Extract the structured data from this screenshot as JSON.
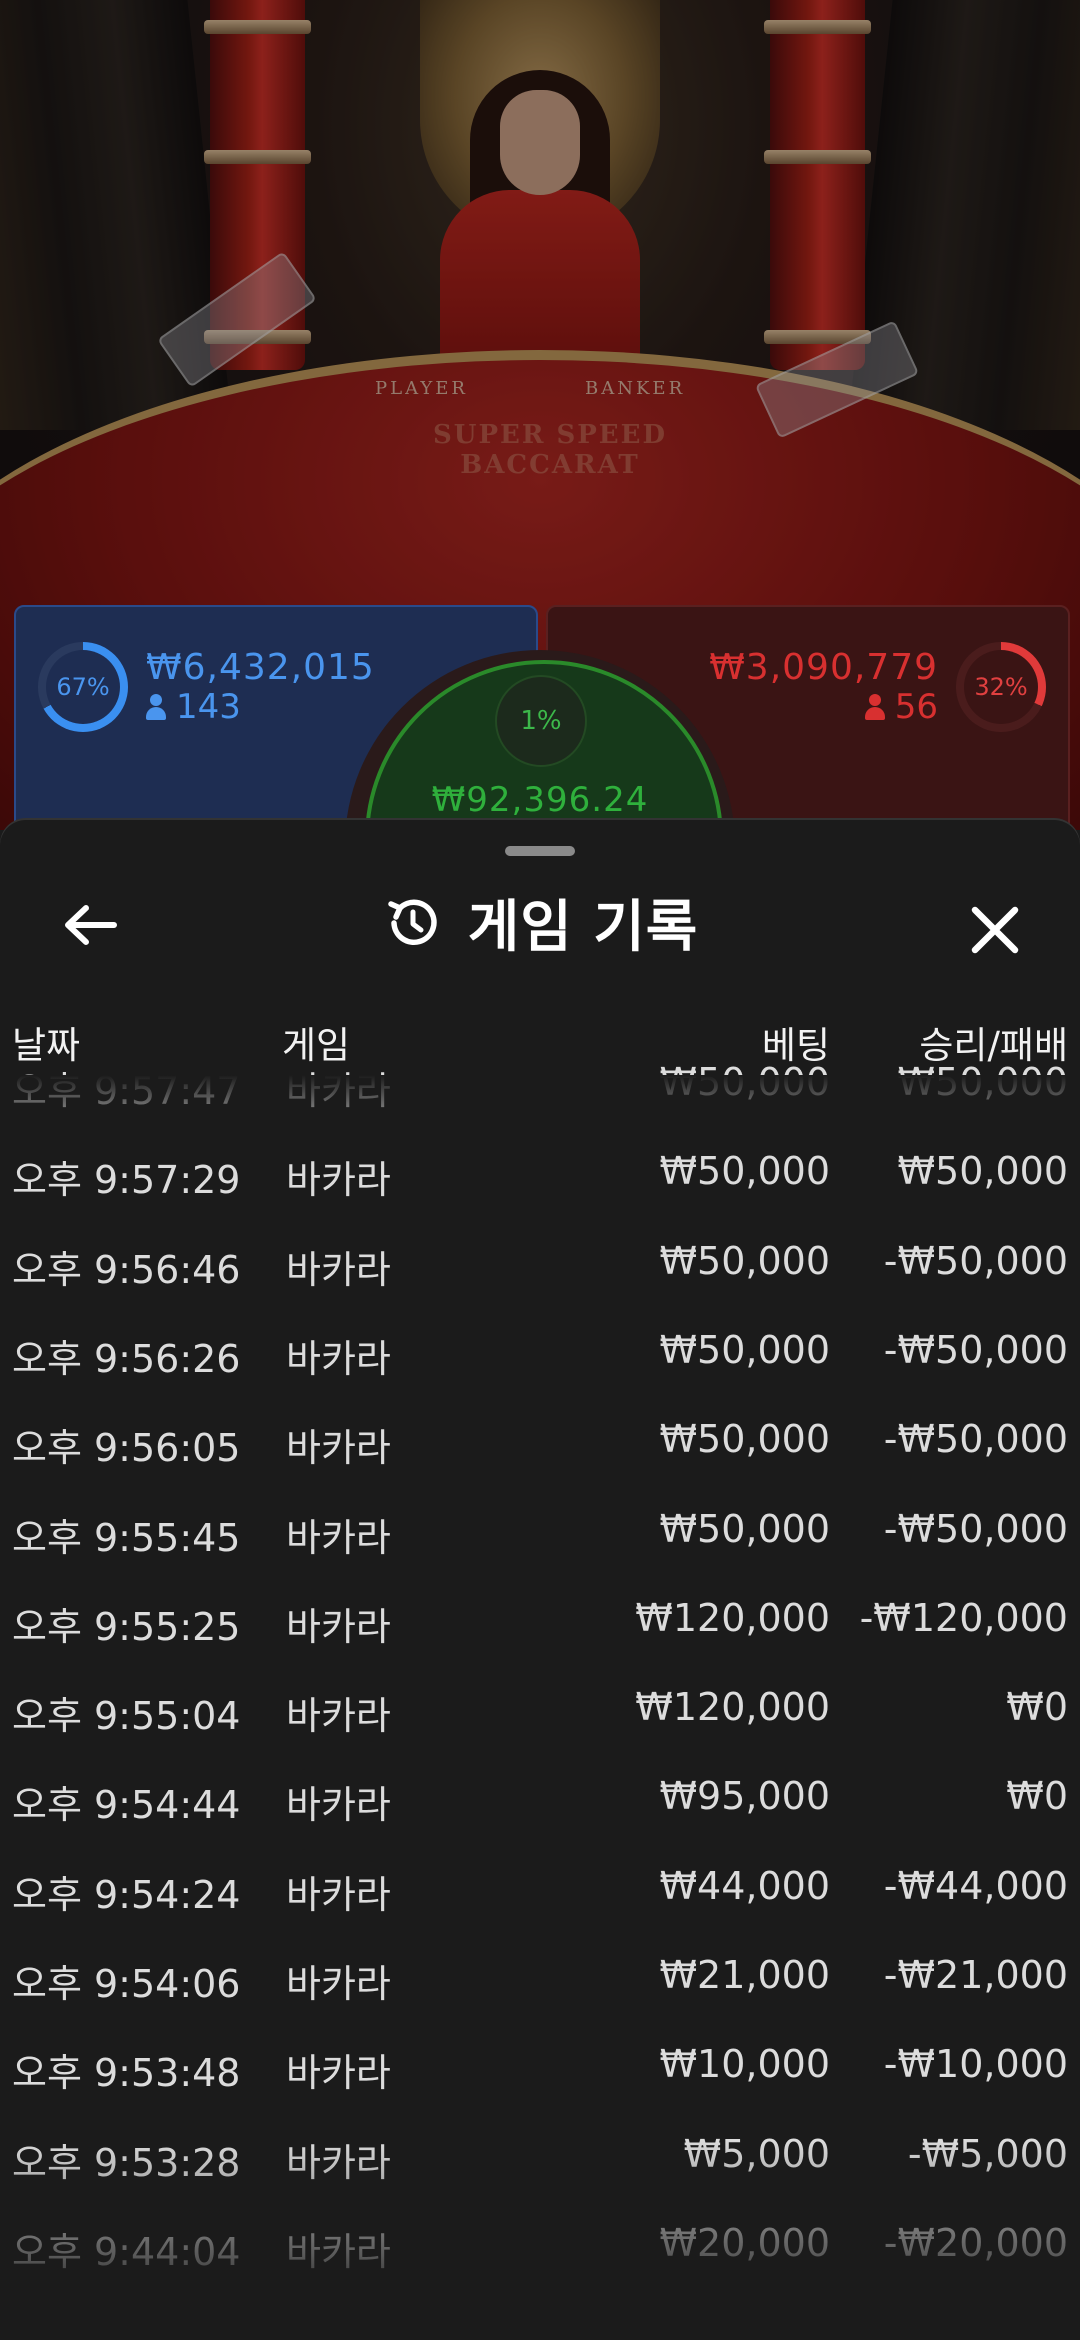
{
  "stage": {
    "table_labels": {
      "player": "PLAYER",
      "banker": "BANKER"
    },
    "table_logo": "SUPER SPEED BACCARAT"
  },
  "bets": {
    "player": {
      "percent": "67%",
      "amount": "₩6,432,015",
      "players": "143",
      "color": "#4a95ee"
    },
    "banker": {
      "percent": "32%",
      "amount": "₩3,090,779",
      "players": "56",
      "color": "#d83030"
    },
    "tie": {
      "percent": "1%",
      "amount": "₩92,396.24",
      "color": "#2fb03c"
    }
  },
  "history": {
    "title": "게임 기록",
    "icons": {
      "back": "arrow-left-icon",
      "history": "history-icon",
      "close": "close-icon"
    },
    "columns": {
      "date": "날짜",
      "game": "게임",
      "bet": "베팅",
      "result": "승리/패배"
    },
    "rows": [
      {
        "time": "오후 9:57:47",
        "game": "바카라",
        "bet": "₩50,000",
        "result": "₩50,000"
      },
      {
        "time": "오후 9:57:29",
        "game": "바카라",
        "bet": "₩50,000",
        "result": "₩50,000"
      },
      {
        "time": "오후 9:56:46",
        "game": "바카라",
        "bet": "₩50,000",
        "result": "-₩50,000"
      },
      {
        "time": "오후 9:56:26",
        "game": "바카라",
        "bet": "₩50,000",
        "result": "-₩50,000"
      },
      {
        "time": "오후 9:56:05",
        "game": "바카라",
        "bet": "₩50,000",
        "result": "-₩50,000"
      },
      {
        "time": "오후 9:55:45",
        "game": "바카라",
        "bet": "₩50,000",
        "result": "-₩50,000"
      },
      {
        "time": "오후 9:55:25",
        "game": "바카라",
        "bet": "₩120,000",
        "result": "-₩120,000"
      },
      {
        "time": "오후 9:55:04",
        "game": "바카라",
        "bet": "₩120,000",
        "result": "₩0"
      },
      {
        "time": "오후 9:54:44",
        "game": "바카라",
        "bet": "₩95,000",
        "result": "₩0"
      },
      {
        "time": "오후 9:54:24",
        "game": "바카라",
        "bet": "₩44,000",
        "result": "-₩44,000"
      },
      {
        "time": "오후 9:54:06",
        "game": "바카라",
        "bet": "₩21,000",
        "result": "-₩21,000"
      },
      {
        "time": "오후 9:53:48",
        "game": "바카라",
        "bet": "₩10,000",
        "result": "-₩10,000"
      },
      {
        "time": "오후 9:53:28",
        "game": "바카라",
        "bet": "₩5,000",
        "result": "-₩5,000"
      },
      {
        "time": "오후 9:44:04",
        "game": "바카라",
        "bet": "₩20,000",
        "result": "-₩20,000"
      }
    ]
  }
}
